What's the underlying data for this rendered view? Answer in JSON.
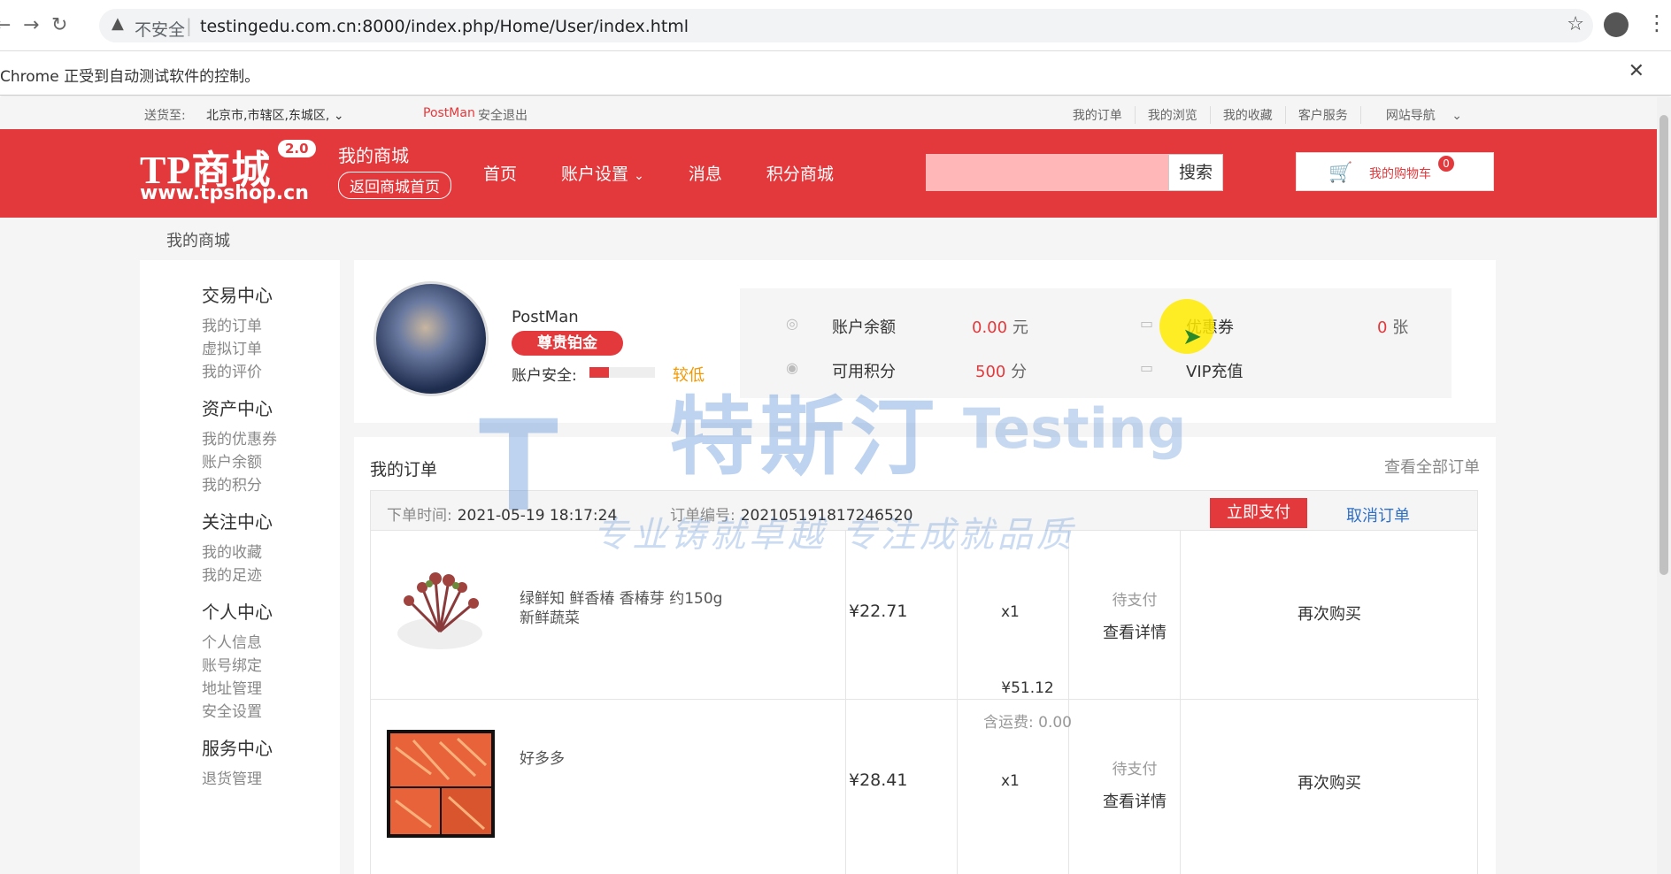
{
  "browser": {
    "security_label": "不安全",
    "url": "testingedu.com.cn:8000/index.php/Home/User/index.html",
    "automation_notice": "Chrome 正受到自动测试软件的控制。"
  },
  "topbar": {
    "deliver_label": "送货至:",
    "location": "北京市,市辖区,东城区,",
    "username": "PostMan",
    "logout": "安全退出",
    "links": [
      "我的订单",
      "我的浏览",
      "我的收藏",
      "客户服务",
      "网站导航"
    ]
  },
  "header": {
    "logo_text": "TP商城",
    "logo_version": "2.0",
    "logo_url": "www.tpshop.cn",
    "mall_title": "我的商城",
    "back_home": "返回商城首页",
    "nav": [
      "首页",
      "账户设置",
      "消息",
      "积分商城"
    ],
    "search_button": "搜索",
    "search_placeholder": "",
    "cart_label": "我的购物车",
    "cart_count": "0"
  },
  "breadcrumb": "我的商城",
  "sidebar": {
    "sections": [
      {
        "title": "交易中心",
        "items": [
          "我的订单",
          "虚拟订单",
          "我的评价"
        ]
      },
      {
        "title": "资产中心",
        "items": [
          "我的优惠券",
          "账户余额",
          "我的积分"
        ]
      },
      {
        "title": "关注中心",
        "items": [
          "我的收藏",
          "我的足迹"
        ]
      },
      {
        "title": "个人中心",
        "items": [
          "个人信息",
          "账号绑定",
          "地址管理",
          "安全设置"
        ]
      },
      {
        "title": "服务中心",
        "items": [
          "退货管理"
        ]
      }
    ]
  },
  "profile": {
    "username": "PostMan",
    "level": "尊贵铂金",
    "security_label": "账户安全:",
    "security_level": "较低",
    "security_fraction": 0.3,
    "assets": {
      "balance_label": "账户余额",
      "balance_value": "0.00",
      "balance_unit": "元",
      "coupon_label": "优惠券",
      "coupon_value": "0",
      "coupon_unit": "张",
      "points_label": "可用积分",
      "points_value": "500",
      "points_unit": "分",
      "vip_label": "VIP充值"
    }
  },
  "orders": {
    "title": "我的订单",
    "view_all": "查看全部订单",
    "order_time_label": "下单时间:",
    "order_time": "2021-05-19 18:17:24",
    "order_no_label": "订单编号:",
    "order_no": "202105191817246520",
    "pay_button": "立即支付",
    "cancel_button": "取消订单",
    "total": "¥51.12",
    "shipping": "含运费: 0.00",
    "items": [
      {
        "name": "绿鲜知 鲜香椿 香椿芽 约150g 新鲜蔬菜",
        "price": "¥22.71",
        "qty": "x1",
        "status": "待支付",
        "detail": "查看详情",
        "rebuy": "再次购买"
      },
      {
        "name": "好多多",
        "price": "¥28.41",
        "qty": "x1",
        "status": "待支付",
        "detail": "查看详情",
        "rebuy": "再次购买"
      }
    ]
  },
  "watermark": {
    "letter": "T",
    "brand_cn": "特斯汀",
    "brand_en": "Testing",
    "slogan": "专业铸就卓越 专注成就品质"
  }
}
